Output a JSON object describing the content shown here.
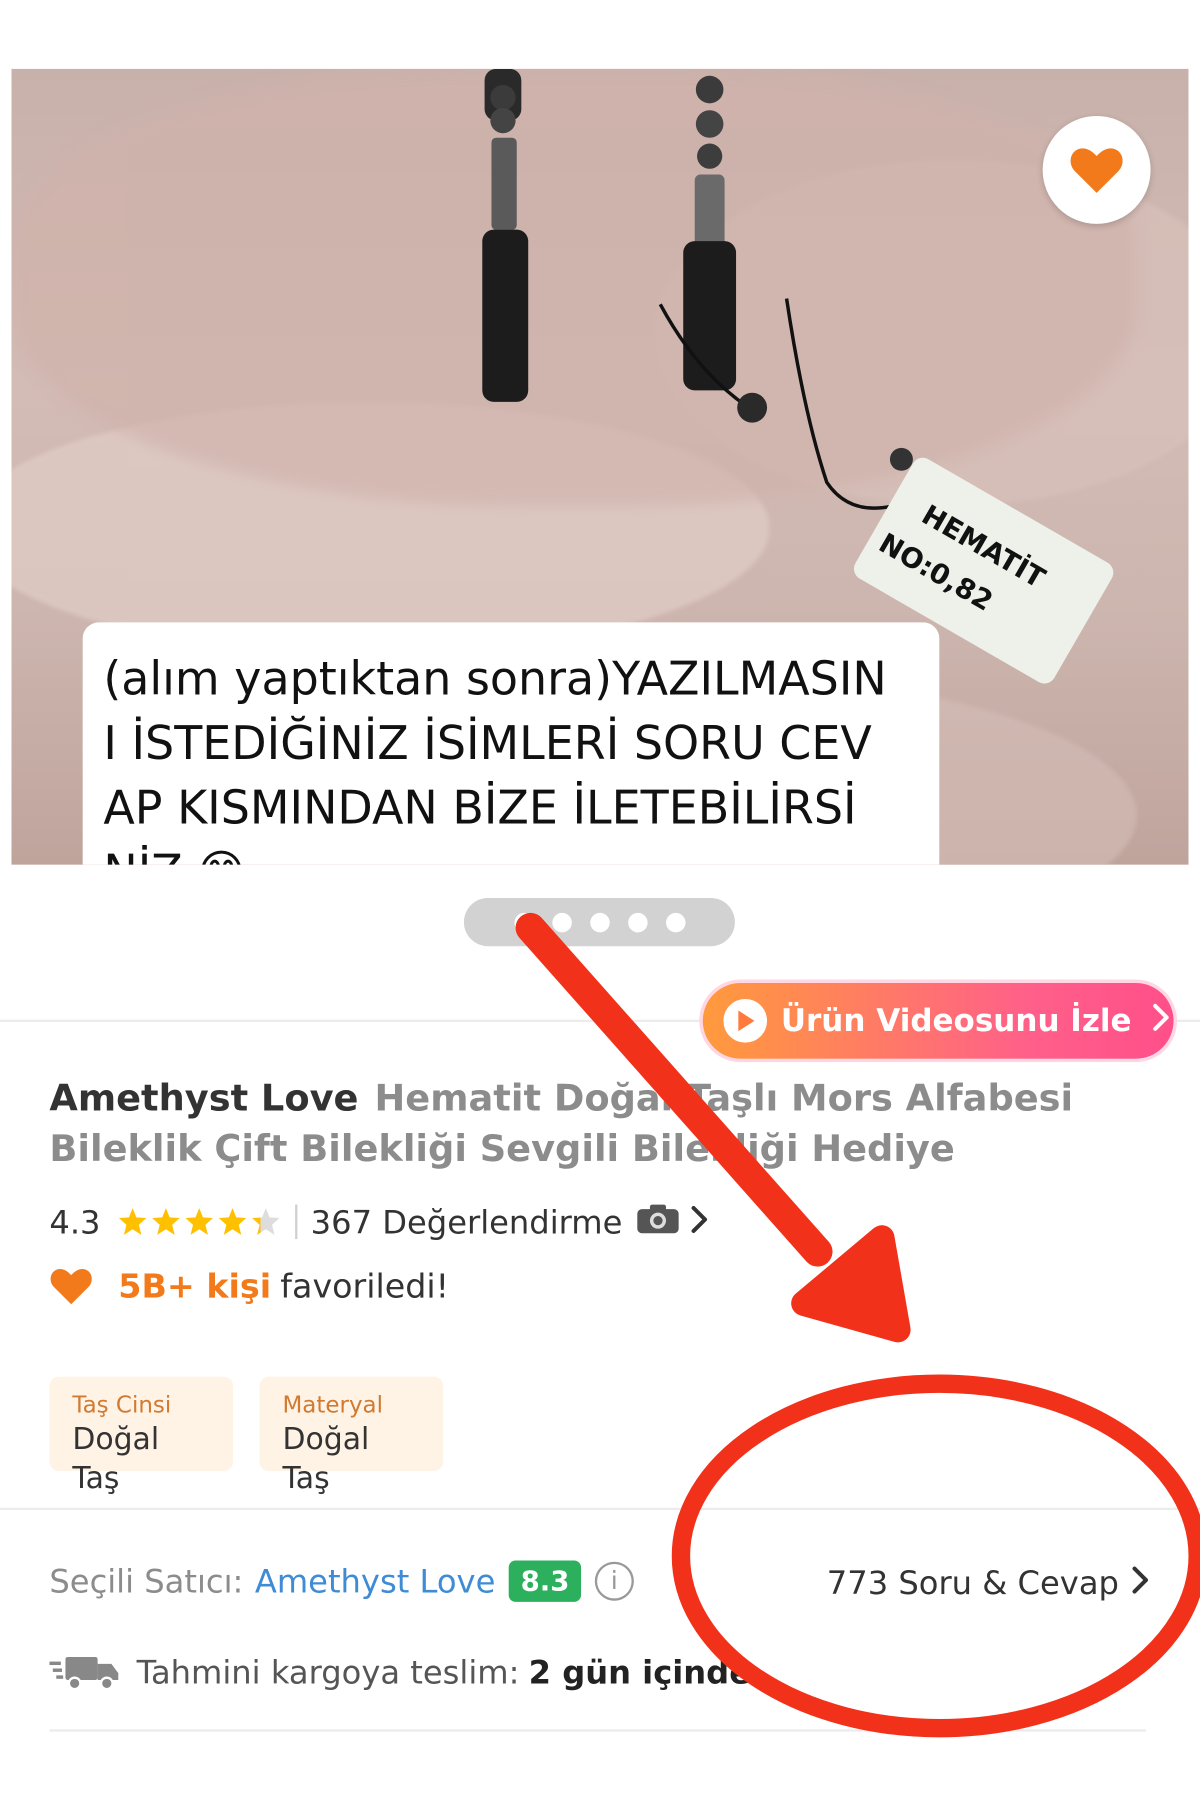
{
  "product_image": {
    "caption_lines": [
      "(alım yaptıktan sonra)YAZILMASIN",
      "I İSTEDİĞİNİZ İSİMLERİ SORU CEV",
      "AP KISMINDAN BİZE İLETEBİLİRSİ",
      "NİZ 😊"
    ],
    "tag_line1": "HEMATİT",
    "tag_line2": "NO:0,82",
    "carousel_count": 5,
    "carousel_active": 1
  },
  "video_button": {
    "label": "Ürün Videosunu İzle"
  },
  "product": {
    "brand": "Amethyst Love",
    "name": "Hematit Doğal Taşlı Mors Alfabesi Bileklik Çift Bilekliği Sevgili Bilekliği Hediye",
    "rating": "4.3",
    "rating_value": 4.3,
    "reviews": "367 Değerlendirme"
  },
  "favorites": {
    "count": "5B+ kişi",
    "text": "favoriledi!"
  },
  "attributes": [
    {
      "key": "Taş Cinsi",
      "value": "Doğal Taş"
    },
    {
      "key": "Materyal",
      "value": "Doğal Taş"
    }
  ],
  "seller": {
    "label": "Seçili Satıcı:",
    "name": "Amethyst Love",
    "score": "8.3"
  },
  "qa": {
    "label": "773 Soru & Cevap"
  },
  "shipping": {
    "label": "Tahmini kargoya teslim:",
    "value": "2 gün içinde"
  },
  "colors": {
    "accent": "#f27a1a",
    "seller_link": "#3e8bd6",
    "score_green": "#2db05d",
    "annotation_red": "#f2311a",
    "star": "#ffc000"
  }
}
